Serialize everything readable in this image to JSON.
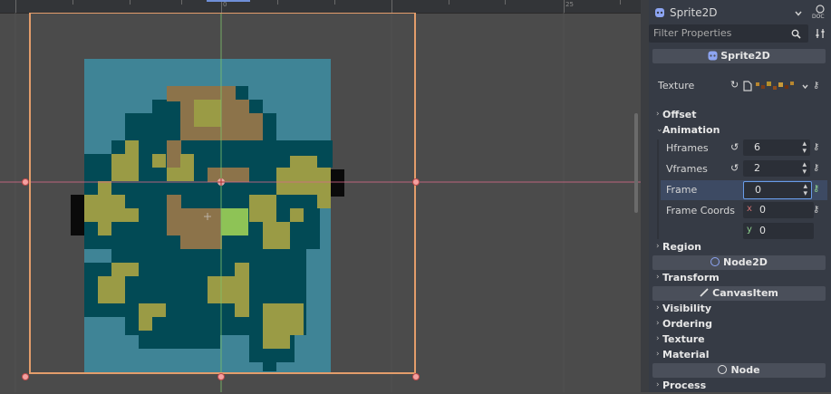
{
  "ruler": {
    "zero_label": "0",
    "right_label": "25"
  },
  "inspector": {
    "node_name": "Sprite2D",
    "doc_label": "DOC",
    "filter_placeholder": "Filter Properties",
    "class_sprite": "Sprite2D",
    "texture_label": "Texture",
    "sections": {
      "offset": "Offset",
      "animation": "Animation",
      "region": "Region",
      "transform": "Transform",
      "visibility": "Visibility",
      "ordering": "Ordering",
      "texture": "Texture",
      "material": "Material",
      "process": "Process"
    },
    "hframes_label": "Hframes",
    "hframes_value": "6",
    "vframes_label": "Vframes",
    "vframes_value": "2",
    "frame_label": "Frame",
    "frame_value": "0",
    "frame_coords_label": "Frame Coords",
    "coord_x_label": "x",
    "coord_x_value": "0",
    "coord_y_label": "y",
    "coord_y_value": "0",
    "class_node2d": "Node2D",
    "class_canvasitem": "CanvasItem",
    "class_node": "Node"
  },
  "colors": {
    "sprite_bg": "#3f8496",
    "sprite_dark": "#024a55",
    "sprite_olive": "#9a9b45",
    "sprite_brown": "#8c734a",
    "selection": "#e39d6b",
    "accent": "#699ce8"
  }
}
